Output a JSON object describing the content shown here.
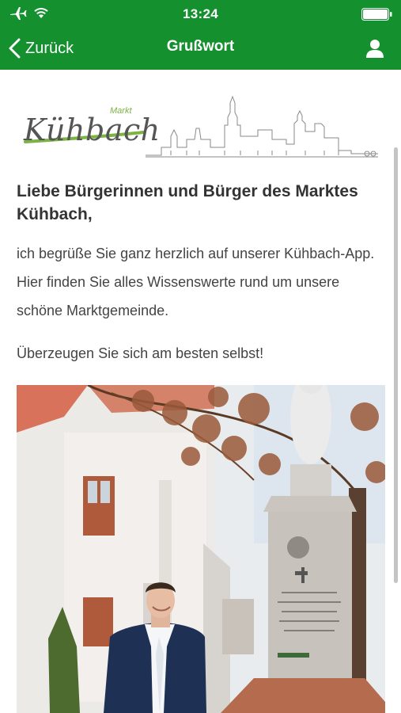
{
  "status_bar": {
    "time": "13:24",
    "icons": [
      "airplane-icon",
      "wifi-icon",
      "battery-icon"
    ]
  },
  "nav": {
    "back_label": "Zurück",
    "title": "Grußwort",
    "profile_icon": "user-icon"
  },
  "logo": {
    "name": "Kühbach",
    "tag": "Markt"
  },
  "content": {
    "headline": "Liebe Bürgerinnen und Bürger des Marktes Kühbach,",
    "paragraph1": "ich begrüße Sie ganz herzlich auf unserer Kühbach-App. Hier finden Sie alles Wissenswerte rund um unsere schöne Marktgemeinde.",
    "paragraph2": "Überzeugen Sie sich am besten selbst!"
  },
  "colors": {
    "brand_green": "#15902f",
    "logo_green": "#7cb342"
  }
}
